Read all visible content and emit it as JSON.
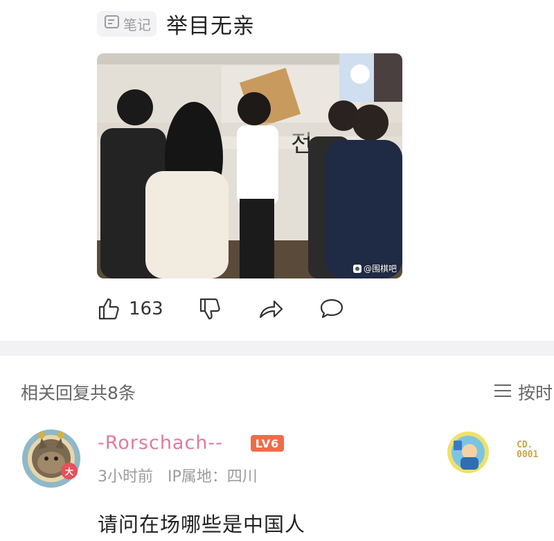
{
  "post": {
    "note_label": "笔记",
    "title": "举目无亲",
    "image_watermark": "@围棋吧",
    "photo_sign_text": "전"
  },
  "actions": {
    "like_count": "163"
  },
  "replies": {
    "title": "相关回复共8条",
    "sort_label": "按时"
  },
  "reply": {
    "username": "-Rorschach--",
    "level": "LV6",
    "time": "3小时前",
    "ip_label": "IP属地：四川",
    "avatar_badge": "大",
    "content": "请问在场哪些是中国人",
    "decor_text": "CD.\n0001"
  },
  "colors": {
    "username": "#e07a9a",
    "level_badge": "#ef6c4a",
    "divider": "#f2f2f4",
    "muted_text": "#9a9aa0"
  }
}
